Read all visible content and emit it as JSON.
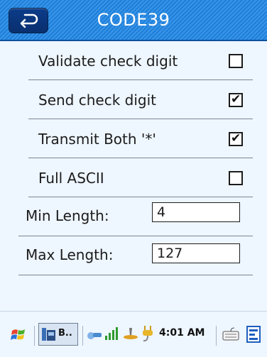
{
  "header": {
    "title": "CODE39"
  },
  "settings": [
    {
      "label": "Validate check digit",
      "checked": false,
      "mark": ""
    },
    {
      "label": "Send check digit",
      "checked": true,
      "mark": "✔"
    },
    {
      "label": "Transmit Both '*'",
      "checked": true,
      "mark": "✔"
    },
    {
      "label": "Full ASCII",
      "checked": false,
      "mark": ""
    }
  ],
  "lengths": {
    "min_label": "Min Length:",
    "min_value": "4",
    "max_label": "Max Length:",
    "max_value": "127"
  },
  "taskbar": {
    "start_icon": "windows-flag-icon",
    "app_button_label": "B..",
    "time": "4:01 AM",
    "icons": [
      "connectivity-icon",
      "signal-strength-icon",
      "volume-icon",
      "power-plug-icon",
      "keyboard-icon"
    ]
  }
}
